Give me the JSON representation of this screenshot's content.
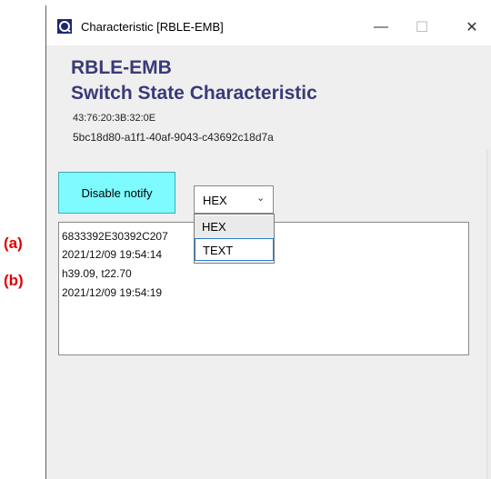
{
  "annotations": {
    "a": "(a)",
    "b": "(b)"
  },
  "window": {
    "title": "Characteristic [RBLE-EMB]",
    "minimize": "—",
    "maximize": "☐",
    "close": "✕"
  },
  "header": {
    "device_name": "RBLE-EMB",
    "characteristic_name": "Switch State Characteristic",
    "mac_address": "43:76:20:3B:32:0E",
    "uuid": "5bc18d80-a1f1-40af-9043-c43692c18d7a"
  },
  "controls": {
    "notify_button": "Disable notify",
    "format_select": {
      "value": "HEX",
      "chevron": "⌄",
      "options": [
        "HEX",
        "TEXT"
      ]
    }
  },
  "log": [
    "6833392E30392C207",
    "2021/12/09 19:54:14",
    "h39.09, t22.70",
    "2021/12/09 19:54:19"
  ]
}
